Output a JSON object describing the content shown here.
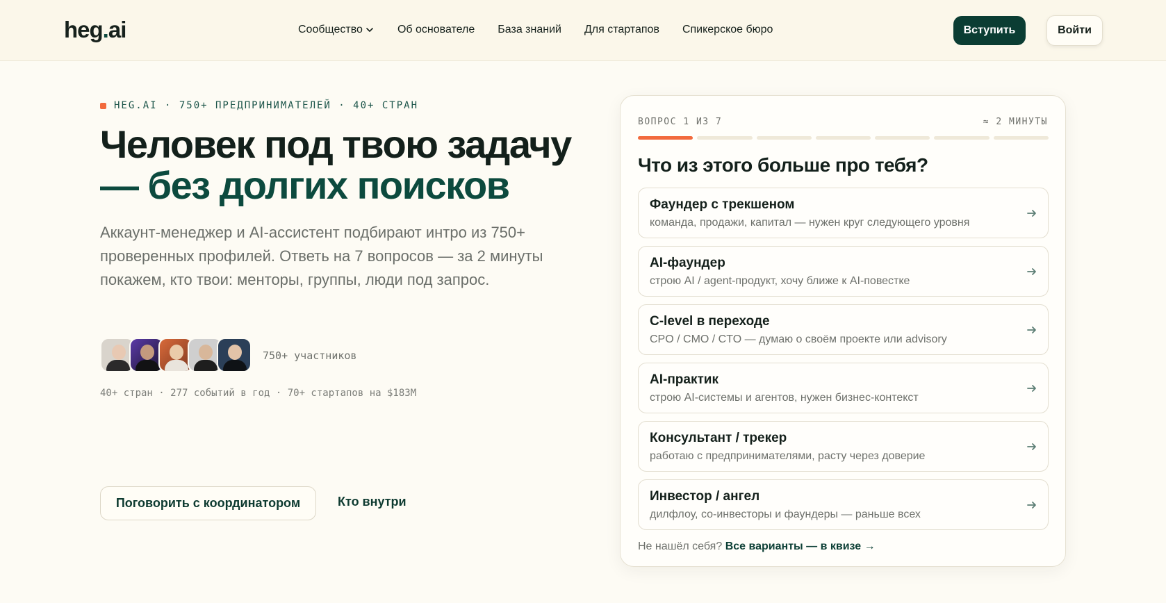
{
  "header": {
    "logo_main": "heg",
    "logo_dot": ".",
    "logo_tail": "ai",
    "nav": [
      {
        "label": "Сообщество",
        "dropdown": true
      },
      {
        "label": "Об основателе"
      },
      {
        "label": "База знаний"
      },
      {
        "label": "Для стартапов"
      },
      {
        "label": "Спикерское бюро"
      }
    ],
    "join_label": "Вступить",
    "login_label": "Войти"
  },
  "hero": {
    "eyebrow": "HEG.AI · 750+ ПРЕДПРИНИМАТЕЛЕЙ · 40+ СТРАН",
    "headline_part1": "Человек под твою задачу",
    "headline_part2": "— без долгих поисков",
    "lead": "Аккаунт-менеджер и AI-ассистент подбирают интро из 750+ проверенных профилей. Ответь на 7 вопросов — за 2 минуты покажем, кто твои: менторы, группы, люди под запрос.",
    "members_label": "750+ участников",
    "stats": "40+ стран · 277 событий в год · 70+ стартапов на $183M",
    "cta_primary": "Поговорить с координатором",
    "cta_secondary": "Кто внутри"
  },
  "quiz": {
    "question_counter": "ВОПРОС 1 ИЗ 7",
    "duration": "≈ 2 МИНУТЫ",
    "progress": {
      "current": 1,
      "total": 7
    },
    "title": "Что из этого больше про тебя?",
    "options": [
      {
        "title": "Фаундер с трекшеном",
        "subtitle": "команда, продажи, капитал — нужен круг следующего уровня"
      },
      {
        "title": "AI-фаундер",
        "subtitle": "строю AI / agent-продукт, хочу ближе к AI-повестке"
      },
      {
        "title": "C-level в переходе",
        "subtitle": "CPO / CMO / CTO — думаю о своём проекте или advisory"
      },
      {
        "title": "AI-практик",
        "subtitle": "строю AI-системы и агентов, нужен бизнес-контекст"
      },
      {
        "title": "Консультант / трекер",
        "subtitle": "работаю с предпринимателями, расту через доверие"
      },
      {
        "title": "Инвестор / ангел",
        "subtitle": "дилфлоу, со-инвесторы и фаундеры — раньше всех"
      }
    ],
    "footnote_text": "Не нашёл себя?",
    "footnote_link": "Все варианты — в квизе →"
  },
  "colors": {
    "accent_dark_green": "#0b3d33",
    "accent_orange": "#f26a3d",
    "background": "#fdfbf4"
  }
}
